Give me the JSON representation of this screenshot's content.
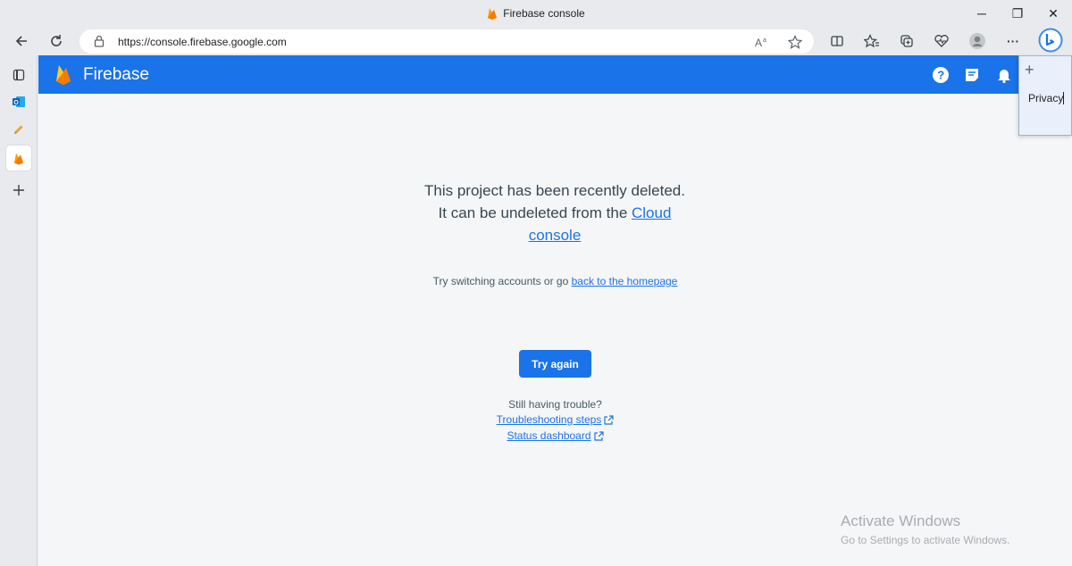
{
  "window": {
    "title": "Firebase console",
    "minimize": "─",
    "maximize": "❐",
    "close": "✕"
  },
  "toolbar": {
    "url": "https://console.firebase.google.com",
    "more": "···"
  },
  "header": {
    "brand": "Firebase"
  },
  "main": {
    "message_part1": "This project has been recently deleted. It can be undeleted from the ",
    "message_link": "Cloud console",
    "switch_text": "Try switching accounts or go ",
    "switch_link": "back to the homepage",
    "try_again": "Try again",
    "trouble": "Still having trouble?",
    "troubleshooting": "Troubleshooting steps",
    "status": "Status dashboard"
  },
  "watermark": {
    "line1": "Activate Windows",
    "line2": "Go to Settings to activate Windows."
  },
  "popup": {
    "plus": "+",
    "text": "Privacy"
  },
  "colors": {
    "accent": "#1a73e8",
    "header_bg": "#1a73e8",
    "firebase_yellow": "#ffca28",
    "firebase_orange": "#f57c00"
  }
}
